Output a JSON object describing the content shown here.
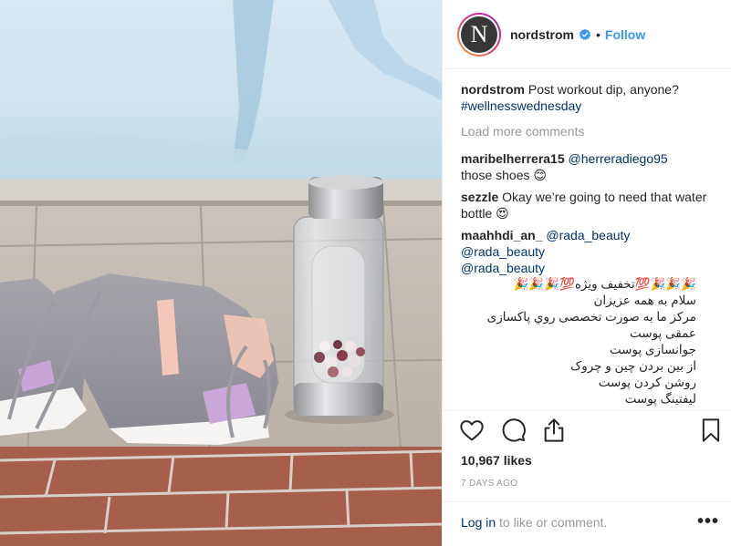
{
  "post": {
    "username": "nordstrom",
    "avatar_letter": "N",
    "follow_label": "Follow",
    "separator": "•"
  },
  "caption": {
    "username": "nordstrom",
    "text": "Post workout dip, anyone?",
    "hashtag": "#wellnesswednesday"
  },
  "load_more": "Load more comments",
  "comments": [
    {
      "user": "maribelherrera15",
      "mention": "@herreradiego95",
      "text": "those shoes 😊"
    },
    {
      "user": "sezzle",
      "text": "Okay we’re going to need that water bottle 😍"
    }
  ],
  "spam_comment": {
    "user": "maahhdi_an_",
    "mention1": "@rada_beauty",
    "mention2": "@rada_beauty",
    "mention3": "@rada_beauty",
    "rtl_lines": [
      "🎉🎉🎉💯تخفیف ویژه💯🎉🎉🎉",
      "سلام به همه عزیزان",
      "مرکز ما به صورت تخصصی روي پاکسازی عمقی پوست",
      "جوانسازی پوست",
      "از بین بردن چین و چروک",
      "روشن کردن پوست",
      "لیفتینگ پوست"
    ]
  },
  "likes": "10,967 likes",
  "time_ago": "7 DAYS AGO",
  "footer": {
    "login_link": "Log in",
    "login_rest": " to like or comment.",
    "more": "•••"
  },
  "icons": {
    "like": "heart-icon",
    "comment": "comment-icon",
    "share": "share-icon",
    "save": "bookmark-icon",
    "verified": "verified-badge-icon"
  },
  "colors": {
    "link": "#3897f0",
    "hashtag": "#003569",
    "muted": "#999999",
    "text": "#262626"
  }
}
